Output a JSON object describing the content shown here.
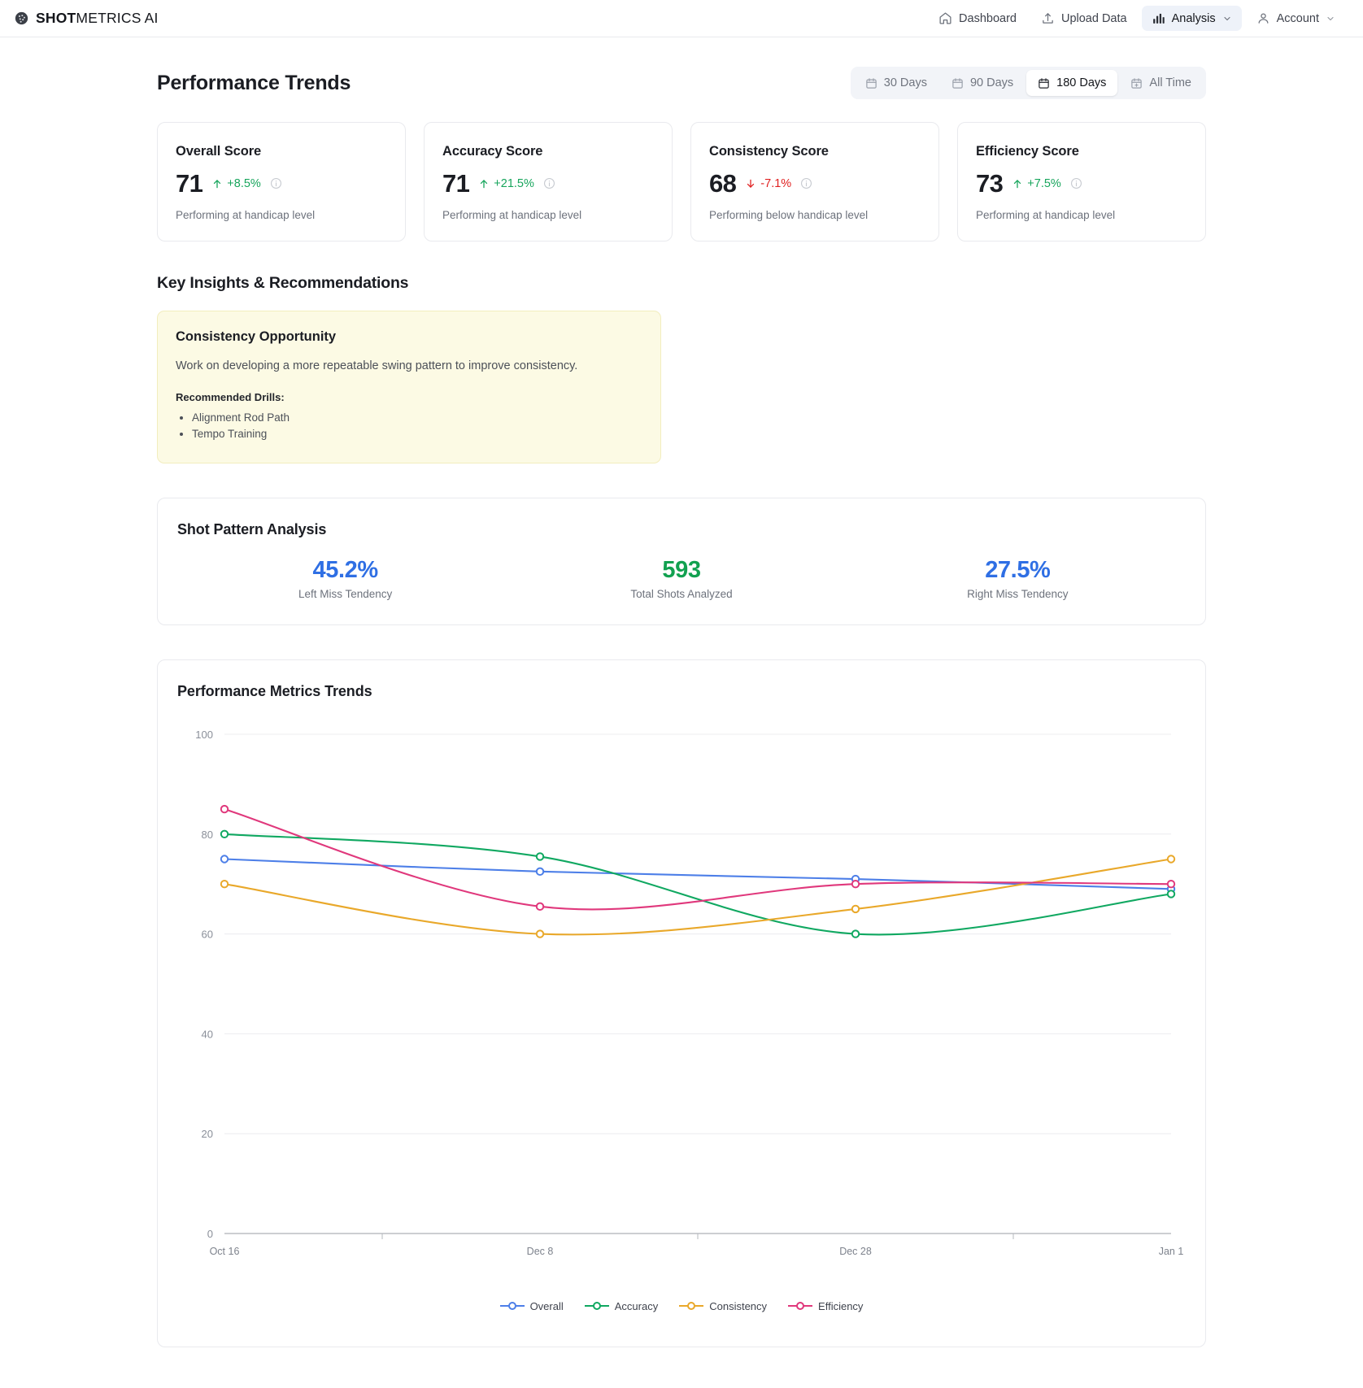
{
  "header": {
    "brand": {
      "name_bold": "SHOT",
      "name_rest": "METRICS AI",
      "icon": "golf-ball-icon"
    },
    "nav": [
      {
        "label": "Dashboard",
        "icon": "home-icon",
        "active": false,
        "chevron": false
      },
      {
        "label": "Upload Data",
        "icon": "upload-icon",
        "active": false,
        "chevron": false
      },
      {
        "label": "Analysis",
        "icon": "bar-chart-icon",
        "active": true,
        "chevron": true
      },
      {
        "label": "Account",
        "icon": "user-icon",
        "active": false,
        "chevron": true
      }
    ]
  },
  "page": {
    "title": "Performance Trends",
    "ranges": [
      {
        "label": "30 Days",
        "icon": "calendar-icon",
        "active": false
      },
      {
        "label": "90 Days",
        "icon": "calendar-icon",
        "active": false
      },
      {
        "label": "180 Days",
        "icon": "calendar-icon",
        "active": true
      },
      {
        "label": "All Time",
        "icon": "calendar-plus-icon",
        "active": false
      }
    ]
  },
  "score_cards": [
    {
      "title": "Overall Score",
      "value": "71",
      "delta": "+8.5%",
      "direction": "up",
      "note": "Performing at handicap level",
      "info_icon": "info-icon"
    },
    {
      "title": "Accuracy Score",
      "value": "71",
      "delta": "+21.5%",
      "direction": "up",
      "note": "Performing at handicap level",
      "info_icon": "info-icon"
    },
    {
      "title": "Consistency Score",
      "value": "68",
      "delta": "-7.1%",
      "direction": "down",
      "note": "Performing below handicap level",
      "info_icon": "info-icon"
    },
    {
      "title": "Efficiency Score",
      "value": "73",
      "delta": "+7.5%",
      "direction": "up",
      "note": "Performing at handicap level",
      "info_icon": "info-icon"
    }
  ],
  "insights": {
    "section_title": "Key Insights & Recommendations",
    "card": {
      "title": "Consistency Opportunity",
      "body": "Work on developing a more repeatable swing pattern to improve consistency.",
      "drills_label": "Recommended Drills:",
      "drills": [
        "Alignment Rod Path",
        "Tempo Training"
      ]
    }
  },
  "shot_pattern": {
    "title": "Shot Pattern Analysis",
    "stats": [
      {
        "value": "45.2%",
        "label": "Left Miss Tendency",
        "color": "#2f6fe4"
      },
      {
        "value": "593",
        "label": "Total Shots Analyzed",
        "color": "#12a150"
      },
      {
        "value": "27.5%",
        "label": "Right Miss Tendency",
        "color": "#2f6fe4"
      }
    ]
  },
  "chart_data": {
    "type": "line",
    "title": "Performance Metrics Trends",
    "xlabel": "",
    "ylabel": "",
    "x": [
      "Oct 16",
      "Dec 8",
      "Dec 28",
      "Jan 1"
    ],
    "yticks": [
      0,
      20,
      40,
      60,
      80,
      100
    ],
    "ylim": [
      0,
      100
    ],
    "grid": true,
    "legend_position": "bottom",
    "smooth": true,
    "series": [
      {
        "name": "Overall",
        "color": "#4d7fe8",
        "values": [
          75,
          72.5,
          71,
          69
        ]
      },
      {
        "name": "Accuracy",
        "color": "#10a861",
        "values": [
          80,
          75.5,
          60,
          68
        ]
      },
      {
        "name": "Consistency",
        "color": "#e9a82a",
        "values": [
          70,
          60,
          65,
          75
        ]
      },
      {
        "name": "Efficiency",
        "color": "#e0387c",
        "values": [
          85,
          65.5,
          70,
          70
        ]
      }
    ]
  }
}
